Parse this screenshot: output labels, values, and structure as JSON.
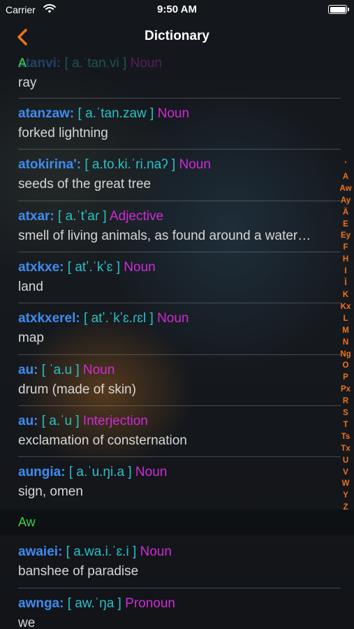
{
  "status_bar": {
    "carrier": "Carrier",
    "time": "9:50 AM"
  },
  "nav": {
    "title": "Dictionary"
  },
  "colors": {
    "accent": "#f0731c",
    "word": "#3f8cf0",
    "ipa": "#29c2c8",
    "pos": "#d02bd6",
    "section": "#3fd13f"
  },
  "top_row": {
    "word": "atanvi:",
    "ipa": "[ a.ˈtan.vi ]",
    "pos": "Noun",
    "definition": "ray",
    "section_label": "A"
  },
  "entries": [
    {
      "word": "atanzaw:",
      "ipa": "[ a.ˈtan.zaw ]",
      "pos": "Noun",
      "definition": "forked lightning"
    },
    {
      "word": "atokirina':",
      "ipa": "[ a.to.ki.ˈri.naʔ ]",
      "pos": "Noun",
      "definition": "seeds of the great tree"
    },
    {
      "word": "atxar:",
      "ipa": "[ a.ˈtʼaɾ ]",
      "pos": "Adjective",
      "definition": "smell of living animals, as found around a water…"
    },
    {
      "word": "atxkxe:",
      "ipa": "[ atʼ.ˈkʼɛ ]",
      "pos": "Noun",
      "definition": "land"
    },
    {
      "word": "atxkxerel:",
      "ipa": "[ atʼ.ˈkʼɛ.ɾɛl ]",
      "pos": "Noun",
      "definition": "map"
    },
    {
      "word": "au:",
      "ipa": "[ ˈa.u ]",
      "pos": "Noun",
      "definition": "drum (made of skin)"
    },
    {
      "word": "au:",
      "ipa": "[ a.ˈu ]",
      "pos": "Interjection",
      "definition": "exclamation of consternation"
    },
    {
      "word": "aungia:",
      "ipa": "[ a.ˈu.ŋi.a ]",
      "pos": "Noun",
      "definition": "sign, omen"
    }
  ],
  "section_aw": {
    "label": "Aw"
  },
  "entries_aw": [
    {
      "word": "awaiei:",
      "ipa": "[ a.wa.i.ˈɛ.i ]",
      "pos": "Noun",
      "definition": "banshee of paradise"
    },
    {
      "word": "awnga:",
      "ipa": "[ aw.ˈŋa ]",
      "pos": "Pronoun",
      "definition": "we"
    }
  ],
  "index": [
    "'",
    "A",
    "Aw",
    "Ay",
    "Ä",
    "E",
    "Ey",
    "F",
    "H",
    "I",
    "Ì",
    "K",
    "Kx",
    "L",
    "M",
    "N",
    "Ng",
    "O",
    "P",
    "Px",
    "R",
    "S",
    "T",
    "Ts",
    "Tx",
    "U",
    "V",
    "W",
    "Y",
    "Z"
  ]
}
